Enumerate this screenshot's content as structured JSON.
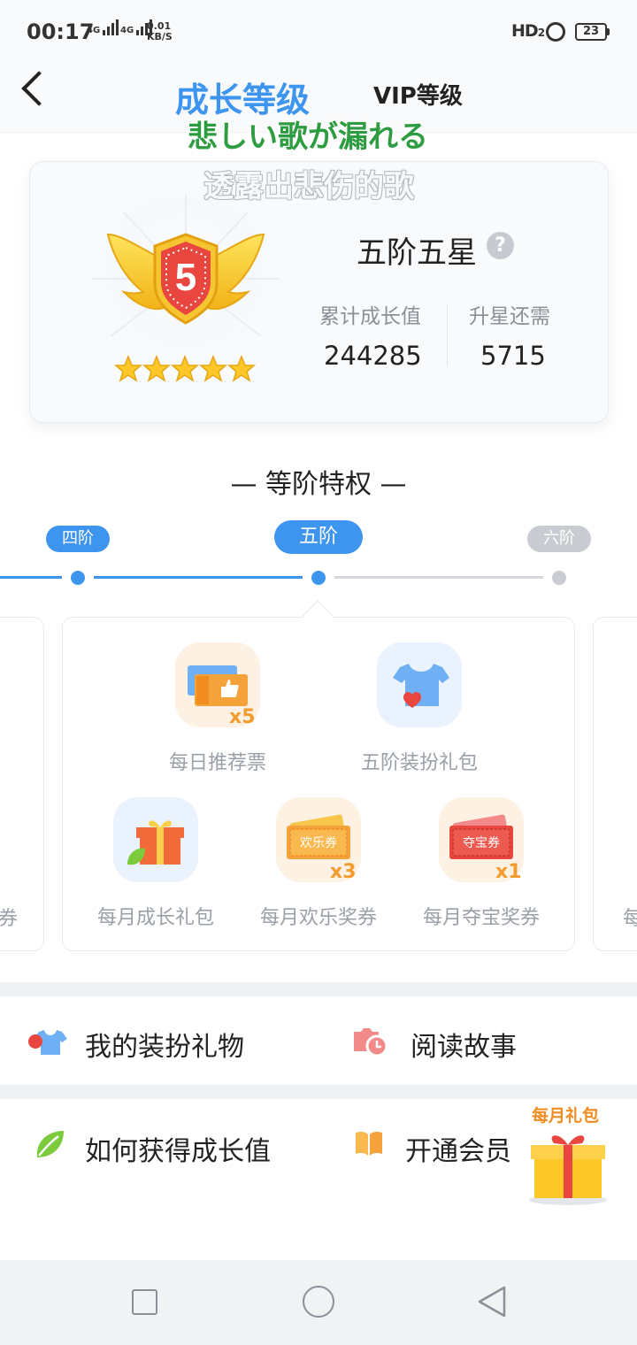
{
  "status": {
    "time": "00:17",
    "net1": "4G",
    "net2": "4G",
    "speed_value": "0.01",
    "speed_unit": "KB/S",
    "hd": "HD",
    "hd_sub": "2",
    "battery": "23"
  },
  "header": {
    "tab_growth": "成长等级",
    "tab_vip": "VIP等级",
    "overlay_line1": "悲しい歌が漏れる",
    "overlay_line2": "透露出悲伤的歌"
  },
  "level": {
    "badge_number": "5",
    "stars": 5,
    "name": "五阶五星",
    "help": "?",
    "total_label": "累计成长值",
    "total_value": "244285",
    "need_label": "升星还需",
    "need_value": "5715"
  },
  "privileges": {
    "title": "— 等阶特权 —",
    "tiers": [
      "四阶",
      "五阶",
      "六阶"
    ],
    "current_tier_index": 1,
    "left_peek_text": "券",
    "right_peek_text": "每",
    "items": [
      {
        "label": "每日推荐票",
        "icon": "ticket-thumb-icon",
        "mult": "x5"
      },
      {
        "label": "五阶装扮礼包",
        "icon": "shirt-heart-icon",
        "mult": ""
      },
      {
        "label": "每月成长礼包",
        "icon": "gift-leaf-icon",
        "mult": ""
      },
      {
        "label": "每月欢乐奖券",
        "icon": "joy-ticket-icon",
        "ticket_text": "欢乐券",
        "mult": "x3"
      },
      {
        "label": "每月夺宝奖券",
        "icon": "treasure-ticket-icon",
        "ticket_text": "夺宝券",
        "mult": "x1"
      }
    ]
  },
  "links": {
    "my_outfit": "我的装扮礼物",
    "read_story": "阅读故事",
    "how_growth": "如何获得成长值",
    "open_member": "开通会员",
    "monthly_gift": "每月礼包"
  },
  "colors": {
    "accent": "#3d95ef",
    "overlay_green": "#2e9c40",
    "muted": "#9aa0a8"
  }
}
